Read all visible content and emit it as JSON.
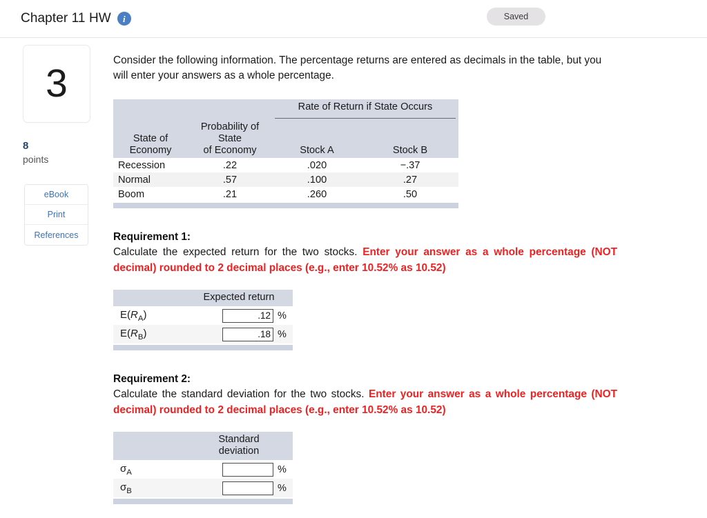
{
  "header": {
    "title": "Chapter 11 HW",
    "info_icon": "info-icon",
    "saved_label": "Saved"
  },
  "sidebar": {
    "question_number": "3",
    "points_value": "8",
    "points_label": "points",
    "buttons": [
      {
        "label": "eBook"
      },
      {
        "label": "Print"
      },
      {
        "label": "References"
      }
    ]
  },
  "main": {
    "intro": "Consider the following information.  The percentage returns are entered as decimals in the table, but you will enter your answers as a whole percentage.",
    "data_table": {
      "span_header": "Rate of Return if State Occurs",
      "col_state_line1": "State of",
      "col_state_line2": "Economy",
      "col_prob_line1": "Probability of",
      "col_prob_line2": "State",
      "col_prob_line3": "of Economy",
      "col_a": "Stock A",
      "col_b": "Stock B",
      "rows": [
        {
          "state": "Recession",
          "probability": ".22",
          "stock_a": ".020",
          "stock_b": "−.37"
        },
        {
          "state": "Normal",
          "probability": ".57",
          "stock_a": ".100",
          "stock_b": ".27"
        },
        {
          "state": "Boom",
          "probability": ".21",
          "stock_a": ".260",
          "stock_b": ".50"
        }
      ]
    },
    "requirement1": {
      "title": "Requirement 1:",
      "text_plain": "Calculate the expected return for the two stocks. ",
      "text_emph": "Enter your answer as a whole percentage (NOT decimal) rounded to 2 decimal places (e.g., enter 10.52% as 10.52)",
      "table": {
        "header": "Expected return",
        "header_line1": "Expected return",
        "header_line2": "",
        "rows": [
          {
            "label_pre": "E(",
            "label_var": "R",
            "label_sub": "A",
            "label_post": ")",
            "value": ".12",
            "unit": "%"
          },
          {
            "label_pre": "E(",
            "label_var": "R",
            "label_sub": "B",
            "label_post": ")",
            "value": ".18",
            "unit": "%"
          }
        ]
      }
    },
    "requirement2": {
      "title": "Requirement 2:",
      "text_plain": "Calculate the standard deviation for the two stocks. ",
      "text_emph": "Enter your answer as a whole percentage (NOT decimal) rounded to 2 decimal places (e.g., enter 10.52% as 10.52)",
      "table": {
        "header_line1": "Standard",
        "header_line2": "deviation",
        "rows": [
          {
            "label_pre": "σ",
            "label_sub": "A",
            "value": "",
            "unit": "%"
          },
          {
            "label_pre": "σ",
            "label_sub": "B",
            "value": "",
            "unit": "%"
          }
        ]
      }
    }
  },
  "colors": {
    "header_band": "#d3d8e3",
    "footer_bar": "#ccd2e0",
    "emphasis_red": "#ee2222",
    "link_blue": "#3f72b5",
    "info_blue": "#4a7fc1",
    "points_navy": "#24456e"
  }
}
